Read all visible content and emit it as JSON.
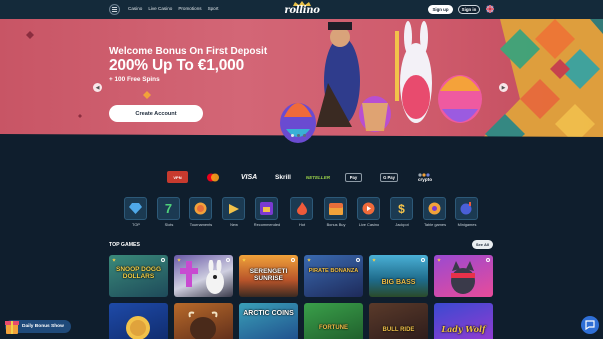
{
  "header": {
    "logo": "rollino",
    "nav": [
      "Casino",
      "Live Casino",
      "Promotions",
      "Sport"
    ],
    "signup_label": "Sign up",
    "signin_label": "Sign in"
  },
  "hero": {
    "title": "Welcome Bonus On First Deposit",
    "amount": "200% Up To €1,000",
    "spins": "+ 100 Free Spins",
    "cta_label": "Create Account",
    "slides_total": 3,
    "slide_active": 1
  },
  "payments": [
    {
      "label": "VPN",
      "icon": "vpn-friendly-badge"
    },
    {
      "label": "",
      "icon": "mastercard-logo"
    },
    {
      "label": "VISA",
      "icon": "visa-logo"
    },
    {
      "label": "Skrill",
      "icon": "skrill-logo"
    },
    {
      "label": "NETELLER",
      "icon": "neteller-logo"
    },
    {
      "label": "Pay",
      "icon": "apple-pay-logo"
    },
    {
      "label": "G Pay",
      "icon": "google-pay-logo"
    },
    {
      "label": "crypto",
      "icon": "crypto-logo"
    }
  ],
  "categories": [
    {
      "label": "TOP",
      "icon": "diamond-icon"
    },
    {
      "label": "Slots",
      "icon": "seven-icon"
    },
    {
      "label": "Tournaments",
      "icon": "trophy-icon"
    },
    {
      "label": "New",
      "icon": "new-flag-icon"
    },
    {
      "label": "Recommended",
      "icon": "thumb-up-icon"
    },
    {
      "label": "Hot",
      "icon": "fire-icon"
    },
    {
      "label": "Bonus Buy",
      "icon": "chest-icon"
    },
    {
      "label": "Live Casino",
      "icon": "play-icon"
    },
    {
      "label": "Jackpot",
      "icon": "dollar-icon"
    },
    {
      "label": "Table games",
      "icon": "cards-icon"
    },
    {
      "label": "Minigames",
      "icon": "bomb-icon"
    }
  ],
  "top_games": {
    "title": "TOP GAMES",
    "see_all_label": "See All",
    "row1": [
      "SNOOP DOGG DOLLARS",
      "",
      "SERENGETI SUNRISE",
      "PIRATE BONANZA",
      "BIG BASS",
      ""
    ],
    "row2": [
      "",
      "",
      "ARCTIC COINS",
      "FORTUNE",
      "BULL RIDE",
      "Lady Wolf"
    ]
  },
  "daily_bonus_label": "Daily Bonus Show",
  "colors": {
    "background": "#0f1e2d",
    "hero": "#d36676",
    "accent_button": "#ffffff",
    "chat": "#2f6fd6"
  }
}
